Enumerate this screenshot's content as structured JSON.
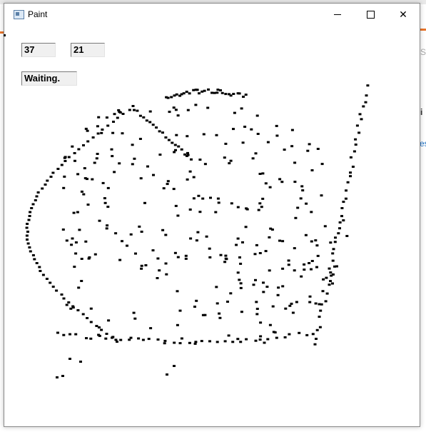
{
  "window": {
    "title": "Paint",
    "icon": "app-window-icon",
    "controls": {
      "minimize": "minimize-icon",
      "maximize": "maximize-icon",
      "close": "close-icon"
    }
  },
  "fields": {
    "x_value": "37",
    "y_value": "21"
  },
  "status": "Waiting.",
  "background": {
    "fragment_1": "S",
    "fragment_2": "i",
    "fragment_3": "es"
  },
  "colors": {
    "accent_orange": "#e8742a",
    "ink": "#000000"
  }
}
